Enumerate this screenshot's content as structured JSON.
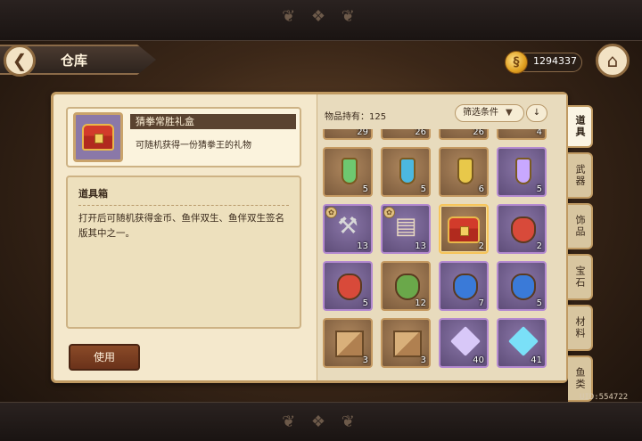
{
  "header": {
    "title": "仓库",
    "gold": "1294337"
  },
  "detail": {
    "name": "猜拳常胜礼盒",
    "short_desc": "可随机获得一份猜拳王的礼物",
    "box_title": "道具箱",
    "box_body": "打开后可随机获得金币、鱼伴双生、鱼伴双生签名版其中之一。",
    "use_label": "使用"
  },
  "inventory": {
    "count_text": "物品持有：125",
    "filter_label": "筛选条件",
    "sort_icon": "↓",
    "rows": [
      [
        {
          "q": "29",
          "k": "brown",
          "t": "bottle",
          "c": "#c8c0a0"
        },
        {
          "q": "26",
          "k": "brown",
          "t": "bottle",
          "c": "#c8c0a0"
        },
        {
          "q": "26",
          "k": "brown",
          "t": "bottle",
          "c": "#c8c0a0"
        },
        {
          "q": "4",
          "k": "brown",
          "t": "bottle",
          "c": "#c8c0a0"
        }
      ],
      [
        {
          "q": "5",
          "k": "brown",
          "t": "bottle",
          "c": "#6ec870"
        },
        {
          "q": "5",
          "k": "brown",
          "t": "bottle",
          "c": "#4cb8e0"
        },
        {
          "q": "6",
          "k": "brown",
          "t": "bottle",
          "c": "#e8c84a"
        },
        {
          "q": "5",
          "k": "purple",
          "t": "bottle",
          "c": "#c8a8ff"
        }
      ],
      [
        {
          "q": "13",
          "k": "purple",
          "t": "hammer",
          "c": "#9a9a9a"
        },
        {
          "q": "13",
          "k": "purple",
          "t": "book",
          "c": "#6a5040"
        },
        {
          "q": "2",
          "k": "brown",
          "t": "chest",
          "c": "#d23b2b",
          "sel": true
        },
        {
          "q": "2",
          "k": "purple",
          "t": "sack",
          "c": "#d84a3a"
        }
      ],
      [
        {
          "q": "5",
          "k": "purple",
          "t": "sack",
          "c": "#d84a3a"
        },
        {
          "q": "12",
          "k": "brown",
          "t": "sack",
          "c": "#6aa84a"
        },
        {
          "q": "7",
          "k": "purple",
          "t": "sack",
          "c": "#3a7ad8"
        },
        {
          "q": "5",
          "k": "purple",
          "t": "sack",
          "c": "#3a7ad8"
        }
      ],
      [
        {
          "q": "3",
          "k": "brown",
          "t": "box",
          "c": "#d84a3a"
        },
        {
          "q": "3",
          "k": "brown",
          "t": "box",
          "c": "#6aa84a"
        },
        {
          "q": "40",
          "k": "purple",
          "t": "heart",
          "c": "#d8c8f8"
        },
        {
          "q": "41",
          "k": "purple",
          "t": "heart",
          "c": "#7ae0f8"
        }
      ]
    ]
  },
  "tabs": [
    "道具",
    "武器",
    "饰品",
    "宝石",
    "材料",
    "鱼类"
  ],
  "uid": "UID:554722"
}
